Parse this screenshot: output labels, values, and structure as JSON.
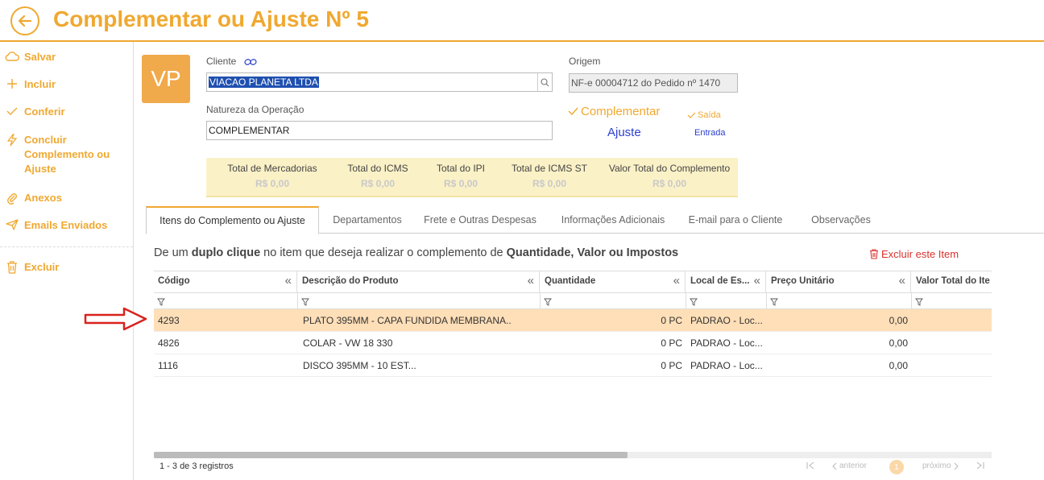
{
  "header": {
    "title": "Complementar ou Ajuste Nº 5"
  },
  "sidebar": {
    "items": [
      {
        "label": "Salvar",
        "icon": "cloud-icon"
      },
      {
        "label": "Incluir",
        "icon": "plus-icon"
      },
      {
        "label": "Conferir",
        "icon": "check-icon"
      },
      {
        "label": "Concluir Complemento ou Ajuste",
        "icon": "bolt-icon"
      },
      {
        "label": "Anexos",
        "icon": "paperclip-icon"
      },
      {
        "label": "Emails Enviados",
        "icon": "send-icon"
      },
      {
        "label": "Excluir",
        "icon": "trash-icon"
      }
    ]
  },
  "form": {
    "avatar": "VP",
    "cliente_label": "Cliente",
    "cliente_value": "VIACAO PLANETA LTDA",
    "natureza_label": "Natureza da Operação",
    "natureza_value": "COMPLEMENTAR",
    "origem_label": "Origem",
    "origem_value": "NF-e 00004712 do Pedido nº 1470",
    "tipo_complementar": "Complementar",
    "tipo_ajuste": "Ajuste",
    "mov_saida": "Saída",
    "mov_entrada": "Entrada"
  },
  "totals": [
    {
      "label": "Total de Mercadorias",
      "value": "R$ 0,00"
    },
    {
      "label": "Total do ICMS",
      "value": "R$ 0,00"
    },
    {
      "label": "Total do IPI",
      "value": "R$ 0,00"
    },
    {
      "label": "Total de ICMS ST",
      "value": "R$ 0,00"
    },
    {
      "label": "Valor Total do Complemento",
      "value": "R$ 0,00"
    }
  ],
  "tabs": [
    "Itens do Complemento ou Ajuste",
    "Departamentos",
    "Frete e Outras Despesas",
    "Informações Adicionais",
    "E-mail para o Cliente",
    "Observações"
  ],
  "hint": {
    "p1": "De um ",
    "b1": "duplo clique",
    "p2": " no item que deseja realizar o complemento de ",
    "b2": "Quantidade, Valor ou Impostos"
  },
  "delete_item": "Excluir este Item",
  "grid": {
    "columns": [
      "Código",
      "Descrição do Produto",
      "Quantidade",
      "Local de Es...",
      "Preço Unitário",
      "Valor Total do Ite"
    ],
    "rows": [
      [
        "4293",
        "PLATO 395MM - CAPA FUNDIDA MEMBRANA..",
        "0 PC",
        "PADRAO - Loc...",
        "0,00"
      ],
      [
        "4826",
        "COLAR - VW 18 330",
        "0 PC",
        "PADRAO - Loc...",
        "0,00"
      ],
      [
        "1116",
        "DISCO 395MM - 10 EST...",
        "0 PC",
        "PADRAO - Loc...",
        "0,00"
      ]
    ]
  },
  "pager": {
    "info": "1 - 3 de 3 registros",
    "prev": "anterior",
    "next": "próximo",
    "page": "1"
  },
  "colors": {
    "accent": "#f0a830",
    "highlight": "#ffdfb8",
    "danger": "#d9322d",
    "link": "#2a3fcf"
  }
}
